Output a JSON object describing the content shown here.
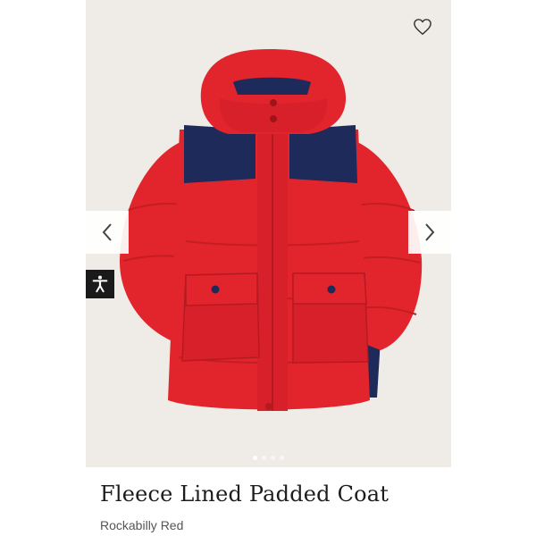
{
  "product": {
    "name": "Fleece Lined Padded Coat",
    "colour": "Rockabilly Red"
  },
  "gallery": {
    "image_count": 4,
    "active_index": 0
  },
  "icons": {
    "wishlist": "heart-outline-icon",
    "previous": "chevron-left-icon",
    "next": "chevron-right-icon",
    "accessibility": "accessibility-person-icon"
  },
  "colors": {
    "image_background": "#efebe7",
    "coat_red": "#e2252c",
    "coat_navy": "#1e2a5a",
    "title_text": "#1d1d1d",
    "subtitle_text": "#555555"
  }
}
